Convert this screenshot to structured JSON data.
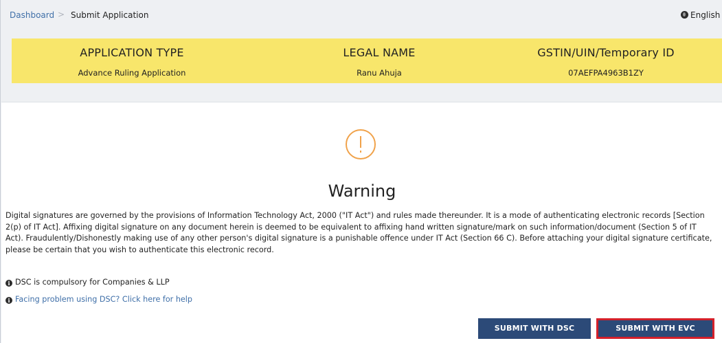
{
  "breadcrumb": {
    "dashboard": "Dashboard",
    "separator": ">",
    "current": "Submit Application"
  },
  "language": {
    "icon": "globe-icon",
    "label": "English"
  },
  "info": {
    "application_type": {
      "heading": "APPLICATION TYPE",
      "value": "Advance Ruling Application"
    },
    "legal_name": {
      "heading": "LEGAL NAME",
      "value": "Ranu Ahuja"
    },
    "gstin": {
      "heading": "GSTIN/UIN/Temporary ID",
      "value": "07AEFPA4963B1ZY"
    }
  },
  "warning": {
    "icon": "warning-circle-icon",
    "title": "Warning",
    "body": "Digital signatures are governed by the provisions of Information Technology Act, 2000 (\"IT Act\") and rules made thereunder. It is a mode of authenticating electronic records [Section 2(p) of IT Act]. Affixing digital signature on any document herein is deemed to be equivalent to affixing hand written signature/mark on such information/document (Section 5 of IT Act). Fraudulently/Dishonestly making use of any other person's digital signature is a punishable offence under IT Act (Section 66 C). Before attaching your digital signature certificate, please be certain that you wish to authenticate this electronic record."
  },
  "notes": {
    "dsc_compulsory": "DSC is compulsory for Companies & LLP",
    "help_link": "Facing problem using DSC? Click here for help"
  },
  "buttons": {
    "submit_dsc": "SUBMIT WITH DSC",
    "submit_evc": "SUBMIT WITH EVC"
  },
  "colors": {
    "accent": "#2c4a78",
    "band": "#f8e66b",
    "warning": "#f0a24a",
    "highlight": "#d4202a",
    "link": "#3f6fa8"
  }
}
